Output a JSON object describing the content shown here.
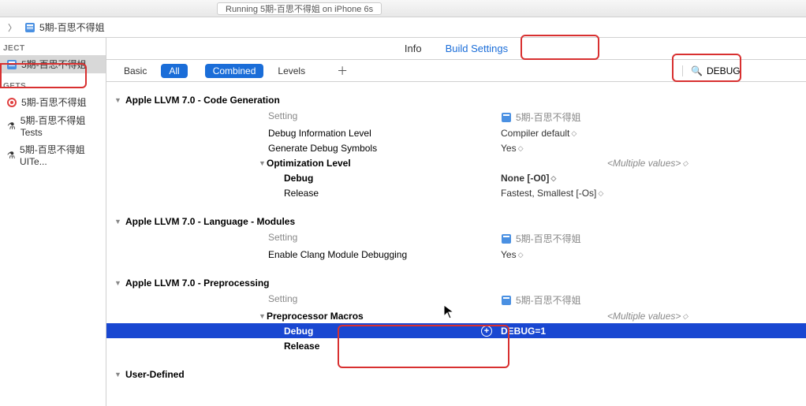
{
  "status_text": "Running 5期-百思不得姐 on iPhone 6s",
  "breadcrumb": {
    "project": "5期-百思不得姐"
  },
  "sidebar": {
    "project_header": "JECT",
    "project_item": "5期-百思不得姐",
    "targets_header": "GETS",
    "targets": [
      {
        "name": "5期-百思不得姐",
        "type": "app"
      },
      {
        "name": "5期-百思不得姐Tests",
        "type": "test"
      },
      {
        "name": "5期-百思不得姐UITe...",
        "type": "test"
      }
    ]
  },
  "tabs": {
    "info": "Info",
    "build_settings": "Build Settings"
  },
  "filters": {
    "basic": "Basic",
    "all": "All",
    "combined": "Combined",
    "levels": "Levels"
  },
  "search": {
    "value": "DEBUG"
  },
  "column_setting": "Setting",
  "column_target": "5期-百思不得姐",
  "sections": {
    "codegen": {
      "title": "Apple LLVM 7.0 - Code Generation",
      "rows": [
        {
          "name": "Debug Information Level",
          "value": "Compiler default"
        },
        {
          "name": "Generate Debug Symbols",
          "value": "Yes"
        }
      ],
      "opt": {
        "title": "Optimization Level",
        "multi": "<Multiple values>",
        "debug_name": "Debug",
        "debug_val": "None [-O0]",
        "release_name": "Release",
        "release_val": "Fastest, Smallest [-Os]"
      }
    },
    "modules": {
      "title": "Apple LLVM 7.0 - Language - Modules",
      "rows": [
        {
          "name": "Enable Clang Module Debugging",
          "value": "Yes"
        }
      ]
    },
    "preproc": {
      "title": "Apple LLVM 7.0 - Preprocessing",
      "macros": {
        "title": "Preprocessor Macros",
        "multi": "<Multiple values>",
        "debug_name": "Debug",
        "debug_val": "DEBUG=1",
        "release_name": "Release",
        "release_val": ""
      }
    },
    "userdef": {
      "title": "User-Defined"
    }
  }
}
